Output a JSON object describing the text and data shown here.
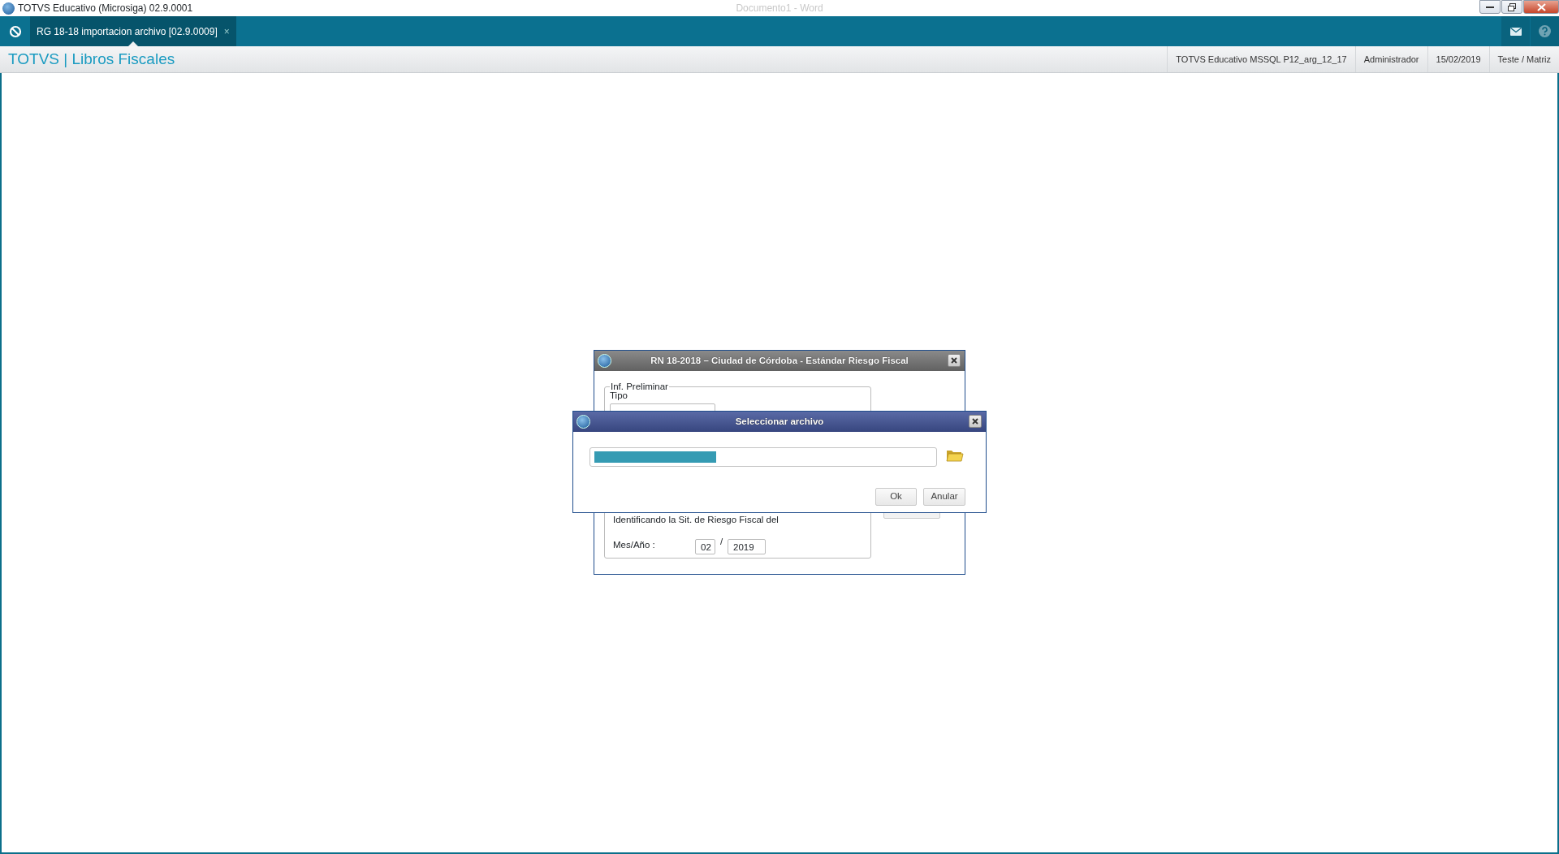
{
  "window": {
    "title": "TOTVS Educativo (Microsiga) 02.9.0001",
    "background_title": "Documento1 - Word"
  },
  "tabs": [
    {
      "label": "RG 18-18 importacion archivo [02.9.0009]",
      "selected": true,
      "close": "×"
    }
  ],
  "header": {
    "title": "TOTVS | Libros Fiscales",
    "info": [
      "TOTVS Educativo MSSQL P12_arg_12_17",
      "Administrador",
      "15/02/2019",
      "Teste / Matriz"
    ]
  },
  "main_dialog": {
    "title": "RN 18-2018 – Ciudad de Córdoba - Estándar Riesgo Fiscal",
    "group": "Inf. Preliminar",
    "tipo_label": "Tipo",
    "description": "Identificando la Sit. de Riesgo Fiscal del",
    "period_label": "Mes/Año :",
    "month": "02",
    "separator": "/",
    "year": "2019"
  },
  "file_dialog": {
    "title": "Seleccionar archivo",
    "path_selected": true,
    "buttons": [
      "Ok",
      "Anular"
    ]
  }
}
